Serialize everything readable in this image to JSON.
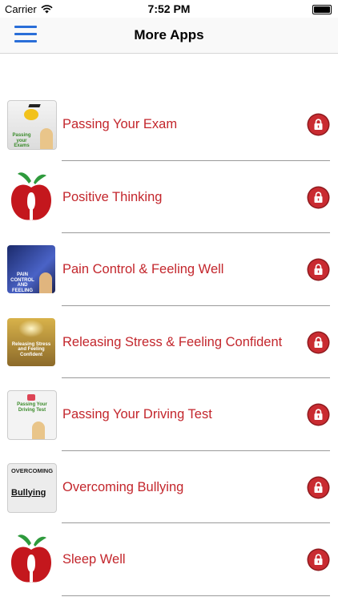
{
  "status_bar": {
    "carrier": "Carrier",
    "time": "7:52 PM",
    "battery_level": 1.0
  },
  "nav": {
    "title": "More Apps",
    "menu_icon": "hamburger-menu-icon"
  },
  "colors": {
    "accent": "#2a6ed8",
    "item_text": "#c3262c",
    "lock_badge": "#c92b31"
  },
  "apps": [
    {
      "label": "Passing Your Exam",
      "thumb": "exam",
      "thumb_text": "Passing your Exams",
      "lock_icon": "lock-icon"
    },
    {
      "label": "Positive Thinking",
      "thumb": "apple",
      "lock_icon": "lock-icon"
    },
    {
      "label": "Pain Control & Feeling Well",
      "thumb": "pain",
      "thumb_text": "PAIN CONTROL AND FEELING WELL",
      "lock_icon": "lock-icon"
    },
    {
      "label": "Releasing Stress & Feeling Confident",
      "thumb": "stress",
      "thumb_text": "Releasing Stress and Feeling Confident",
      "lock_icon": "lock-icon"
    },
    {
      "label": "Passing Your Driving Test",
      "thumb": "driving",
      "thumb_text": "Passing Your Driving Test",
      "lock_icon": "lock-icon"
    },
    {
      "label": "Overcoming Bullying",
      "thumb": "bullying",
      "thumb_text": [
        "OVERCOMING",
        "Bullying"
      ],
      "lock_icon": "lock-icon"
    },
    {
      "label": "Sleep Well",
      "thumb": "apple",
      "lock_icon": "lock-icon"
    }
  ]
}
